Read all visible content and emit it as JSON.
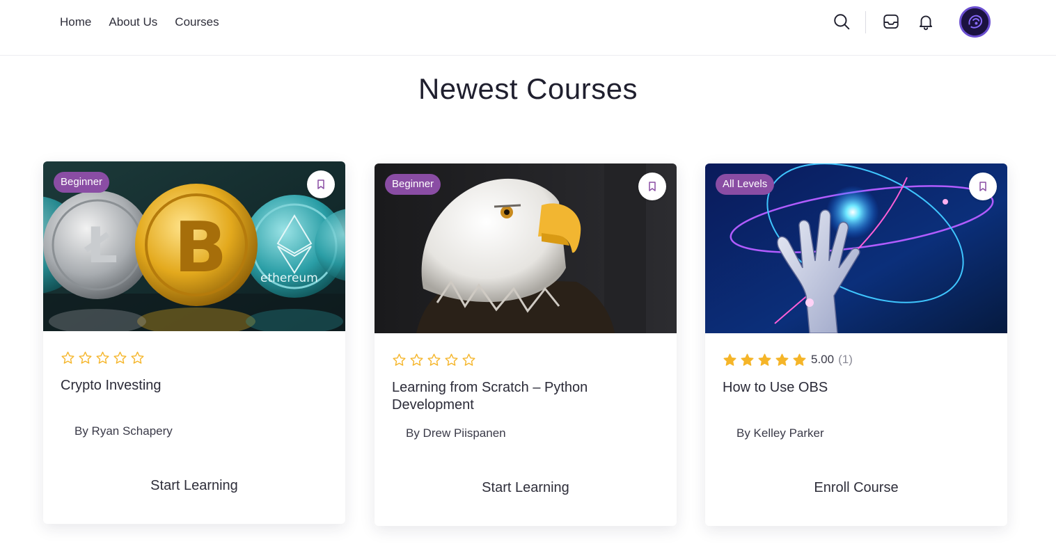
{
  "nav": {
    "items": [
      "Home",
      "About Us",
      "Courses"
    ]
  },
  "header_icons": [
    "search-icon",
    "inbox-icon",
    "bell-icon",
    "user-avatar"
  ],
  "section": {
    "title": "Newest Courses"
  },
  "colors": {
    "badge": "#8a4da4",
    "star": "#f5b529",
    "bookmark": "#8a4da4"
  },
  "courses": [
    {
      "level": "Beginner",
      "image": "crypto-coins",
      "rating_value": "",
      "rating_count": "",
      "stars_filled": 0,
      "title": "Crypto Investing",
      "author": "By Ryan Schapery",
      "cta": "Start Learning"
    },
    {
      "level": "Beginner",
      "image": "bald-eagle",
      "rating_value": "",
      "rating_count": "",
      "stars_filled": 0,
      "title": "Learning from Scratch – Python Development",
      "author": "By Drew Piispanen",
      "cta": "Start Learning"
    },
    {
      "level": "All Levels",
      "image": "robot-hand",
      "rating_value": "5.00",
      "rating_count": "(1)",
      "stars_filled": 5,
      "title": "How to Use OBS",
      "author": "By Kelley Parker",
      "cta": "Enroll Course"
    }
  ]
}
